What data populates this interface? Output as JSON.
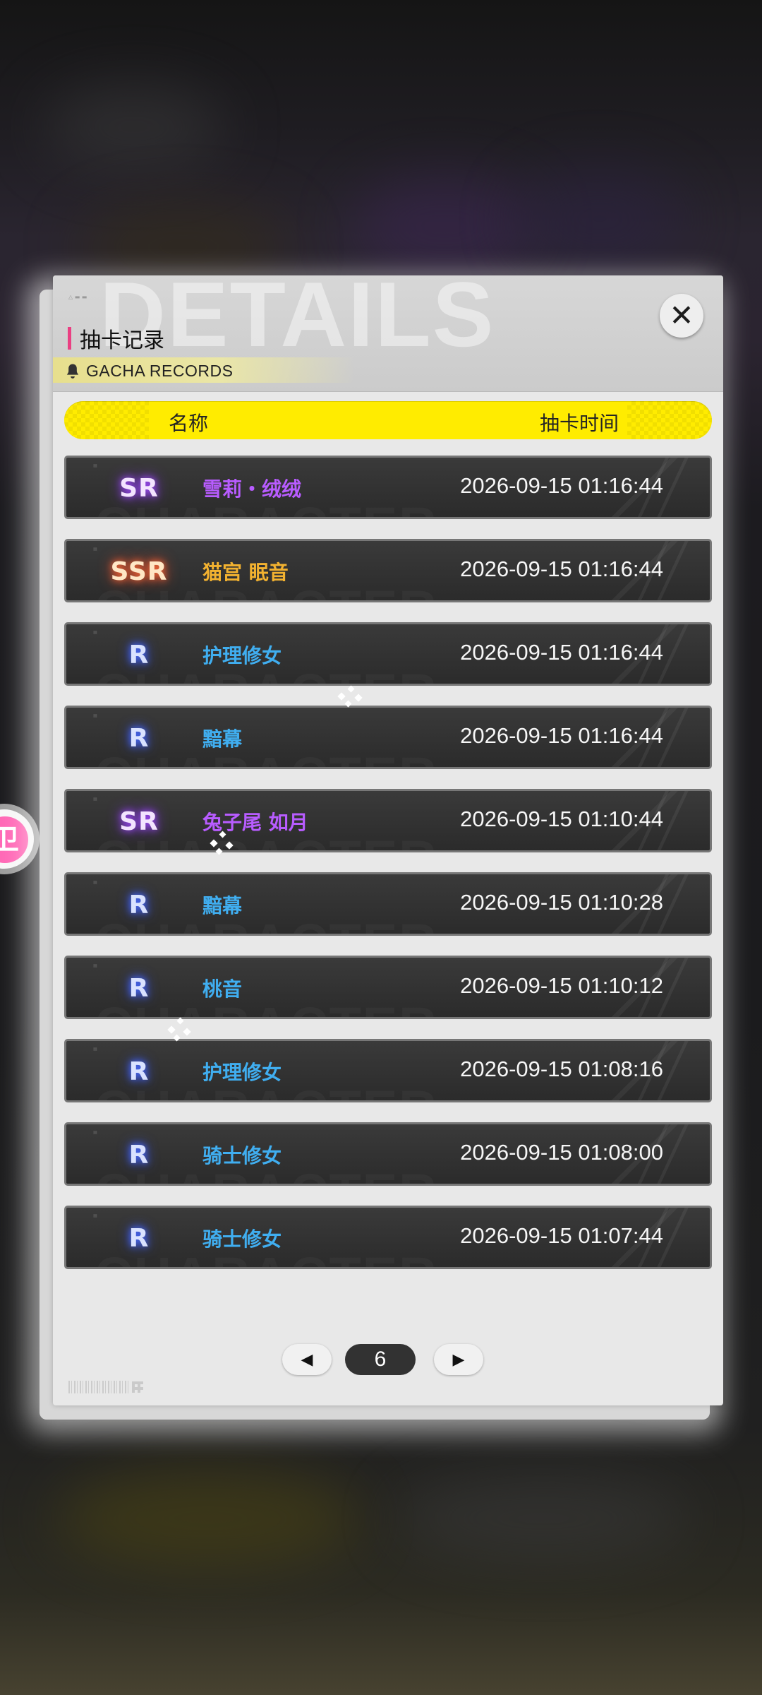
{
  "side_badge": {
    "text": "卫"
  },
  "header": {
    "watermark": "DETAILS",
    "title": "抽卡记录",
    "subtitle": "GACHA RECORDS",
    "close_symbol": "✕"
  },
  "table": {
    "columns": [
      "名称",
      "抽卡时间"
    ],
    "rows": [
      {
        "rarity": "SR",
        "name": "雪莉・绒绒",
        "time": "2026-09-15 01:16:44"
      },
      {
        "rarity": "SSR",
        "name": "猫宫 眠音",
        "time": "2026-09-15 01:16:44"
      },
      {
        "rarity": "R",
        "name": "护理修女",
        "time": "2026-09-15 01:16:44"
      },
      {
        "rarity": "R",
        "name": "黯幕",
        "time": "2026-09-15 01:16:44"
      },
      {
        "rarity": "SR",
        "name": "兔子尾 如月",
        "time": "2026-09-15 01:10:44"
      },
      {
        "rarity": "R",
        "name": "黯幕",
        "time": "2026-09-15 01:10:28"
      },
      {
        "rarity": "R",
        "name": "桃音",
        "time": "2026-09-15 01:10:12"
      },
      {
        "rarity": "R",
        "name": "护理修女",
        "time": "2026-09-15 01:08:16"
      },
      {
        "rarity": "R",
        "name": "骑士修女",
        "time": "2026-09-15 01:08:00"
      },
      {
        "rarity": "R",
        "name": "骑士修女",
        "time": "2026-09-15 01:07:44"
      }
    ],
    "row_watermark": "CHARACTER"
  },
  "pager": {
    "prev_symbol": "◀",
    "page": "6",
    "next_symbol": "▶"
  },
  "colors": {
    "header_yellow": "#ffec00",
    "accent_pink": "#ea3f82",
    "rarity_r": "#4a6dff",
    "rarity_sr": "#a44cff",
    "rarity_ssr": "#ff6b38",
    "name_blue": "#40aef0",
    "name_purple": "#b85cff",
    "name_gold": "#f3b230"
  },
  "icons": {
    "close": "close-icon",
    "bell": "bell-icon",
    "prev": "chevron-left-icon",
    "next": "chevron-right-icon"
  }
}
